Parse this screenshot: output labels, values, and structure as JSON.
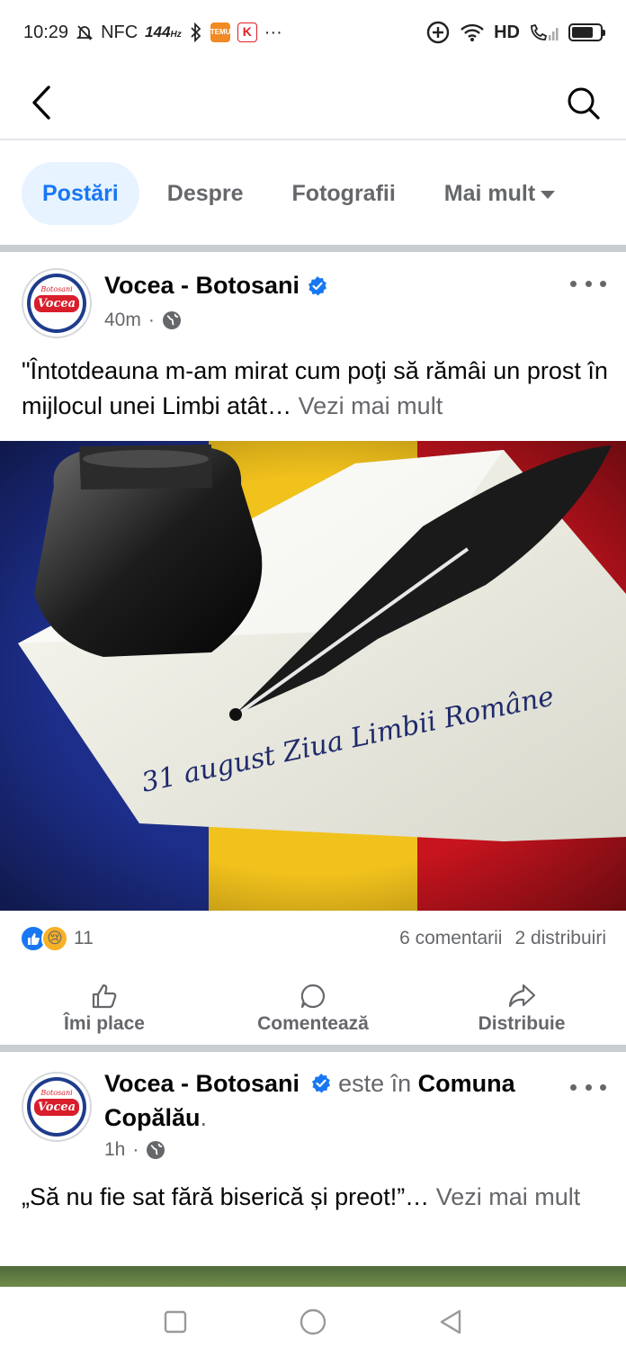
{
  "status": {
    "time": "10:29",
    "nfc": "NFC",
    "refresh": "144",
    "refresh_unit": "Hz",
    "temu_badge": "TEMU",
    "k_badge": "K",
    "more_dots": "···",
    "network": "HD",
    "battery_level": 0.75
  },
  "tabs": [
    {
      "label": "Postări",
      "active": true
    },
    {
      "label": "Despre",
      "active": false
    },
    {
      "label": "Fotografii",
      "active": false
    },
    {
      "label": "Mai mult",
      "active": false
    }
  ],
  "post1": {
    "author": "Vocea - Botosani",
    "logo_top": "Botosani",
    "logo_text": "Vocea",
    "time": "40m",
    "dot": "·",
    "text": "\"Întotdeauna m-am mirat cum poţi să rămâi un prost în mijlocul unei Limbi atât…",
    "see_more": "Vezi mai mult",
    "image_caption": "31 august Ziua Limbii Române",
    "reactions_count": "11",
    "comments": "6 comentarii",
    "shares": "2 distribuiri",
    "actions": {
      "like": "Îmi place",
      "comment": "Comentează",
      "share": "Distribuie"
    }
  },
  "post2": {
    "author": "Vocea - Botosani",
    "location_prefix": "este în",
    "location": "Comuna Copălău",
    "period": ".",
    "logo_top": "Botosani",
    "logo_text": "Vocea",
    "time": "1h",
    "dot": "·",
    "text": "„Să nu fie sat fără biserică și preot!”…",
    "see_more": "Vezi mai mult"
  },
  "colors": {
    "accent": "#1877f2",
    "tab_active_bg": "#e7f3ff",
    "muted": "#65676b",
    "flag_blue": "#1d2e8a",
    "flag_yellow": "#f2c21c",
    "flag_red": "#c8141e"
  },
  "icons": {
    "back": "back-arrow-icon",
    "search": "search-icon",
    "more": "more-dots-icon",
    "verified": "verified-badge-icon",
    "globe": "globe-icon",
    "like": "thumbs-up-icon",
    "comment": "comment-icon",
    "share": "share-icon"
  }
}
